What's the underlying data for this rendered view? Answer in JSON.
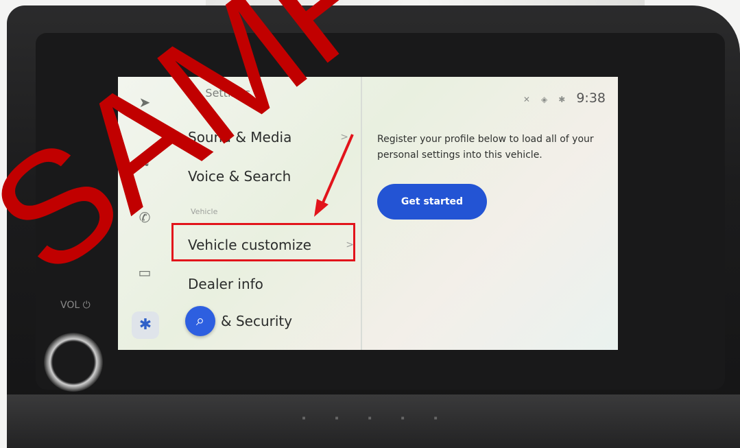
{
  "rail": {
    "icons": [
      "navigation-icon",
      "music-icon",
      "phone-icon",
      "car-icon",
      "gear-icon"
    ]
  },
  "settings": {
    "title": "Settings",
    "items": [
      {
        "label": "Sound & Media",
        "chevron": ">"
      },
      {
        "label": "Voice & Search"
      },
      {
        "label": "Vehicle customize",
        "chevron": ">"
      },
      {
        "label": "Dealer info"
      },
      {
        "label": "& Security"
      }
    ],
    "section_label": "Vehicle"
  },
  "status": {
    "time": "9:38"
  },
  "profile": {
    "text": "Register your profile below to load all of your personal settings into this vehicle.",
    "button": "Get started"
  },
  "bezel": {
    "vol_label": "VOL"
  },
  "watermark": {
    "text": "SAMPLE",
    "color": "#c10000"
  },
  "colors": {
    "accent": "#2354d4",
    "highlight": "#e2141b"
  }
}
